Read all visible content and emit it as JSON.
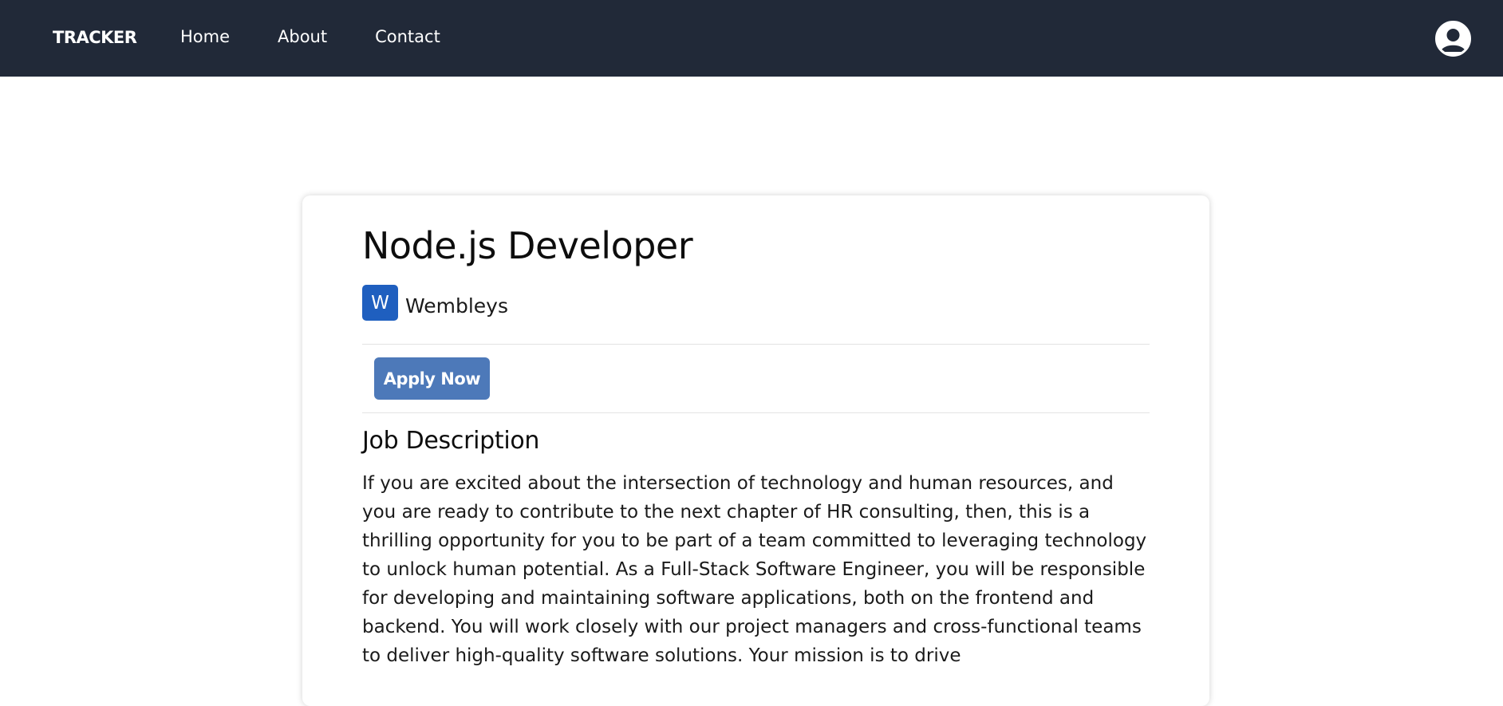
{
  "navbar": {
    "brand": "TRACKER",
    "links": [
      {
        "label": "Home"
      },
      {
        "label": "About"
      },
      {
        "label": "Contact"
      }
    ],
    "avatar_icon": "user-avatar-icon"
  },
  "job": {
    "title": "Node.js Developer",
    "company": {
      "initial": "W",
      "name": "Wembleys",
      "logo_color": "#1f5fbf"
    },
    "apply_label": "Apply Now",
    "description_heading": "Job Description",
    "description": "If you are excited about the intersection of technology and human resources, and you are ready to contribute to the next chapter of HR consulting, then, this is a thrilling opportunity for you to be part of a team committed to leveraging technology to unlock human potential. As a Full-Stack Software Engineer, you will be responsible for developing and maintaining software applications, both on the frontend and backend. You will work closely with our project managers and cross-functional teams to deliver high-quality software solutions. Your mission is to drive"
  },
  "colors": {
    "navbar_bg": "#212938",
    "apply_button": "#4d79b9"
  }
}
